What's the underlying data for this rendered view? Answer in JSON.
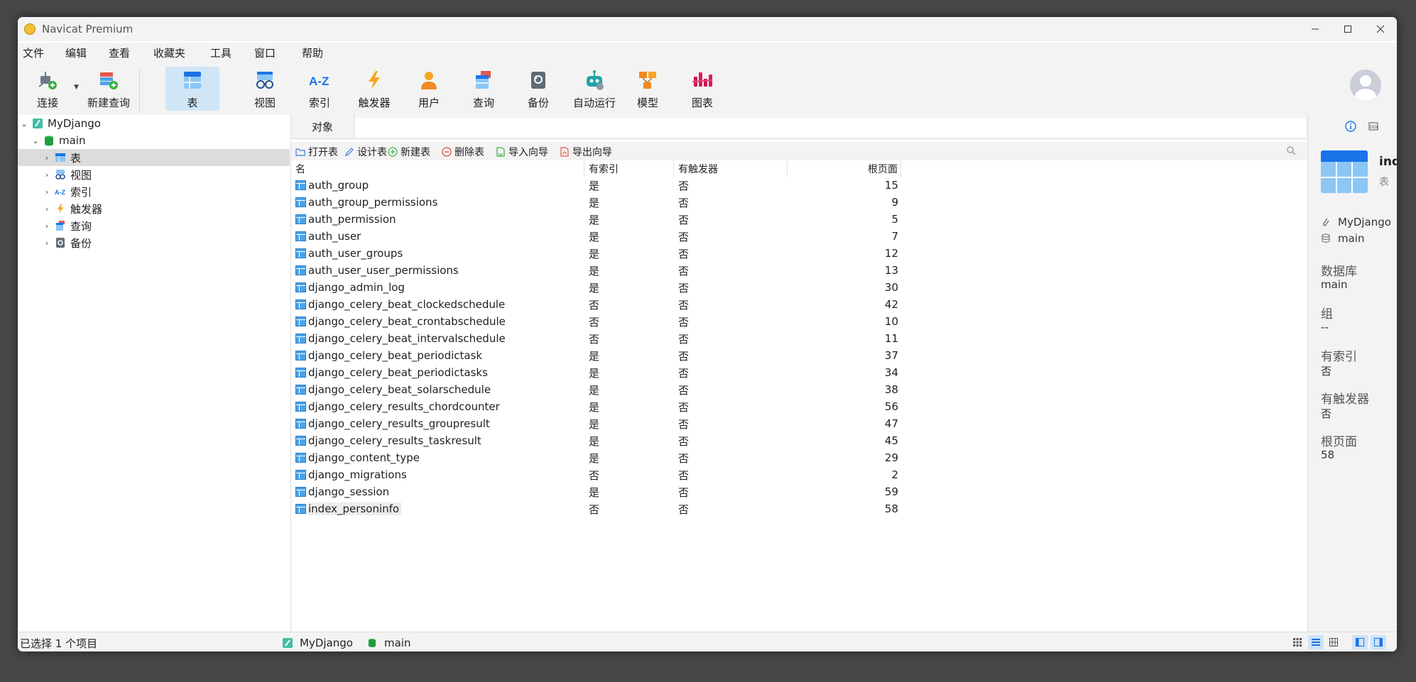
{
  "window": {
    "title": "Navicat Premium"
  },
  "menu": [
    "文件",
    "编辑",
    "查看",
    "收藏夹",
    "工具",
    "窗口",
    "帮助"
  ],
  "toolbar": {
    "connect": "连接",
    "new_query": "新建查询",
    "table": "表",
    "view": "视图",
    "index": "索引",
    "trigger": "触发器",
    "user": "用户",
    "query": "查询",
    "backup": "备份",
    "automation": "自动运行",
    "model": "模型",
    "chart": "图表"
  },
  "tree": {
    "connection": "MyDjango",
    "database": "main",
    "items": [
      "表",
      "视图",
      "索引",
      "触发器",
      "查询",
      "备份"
    ]
  },
  "tab": {
    "objects": "对象"
  },
  "object_toolbar": {
    "open": "打开表",
    "design": "设计表",
    "new": "新建表",
    "delete": "删除表",
    "import": "导入向导",
    "export": "导出向导"
  },
  "table": {
    "headers": [
      "名",
      "有索引",
      "有触发器",
      "根页面"
    ],
    "rows": [
      {
        "name": "auth_group",
        "has_index": "是",
        "has_trigger": "否",
        "root_page": "15"
      },
      {
        "name": "auth_group_permissions",
        "has_index": "是",
        "has_trigger": "否",
        "root_page": "9"
      },
      {
        "name": "auth_permission",
        "has_index": "是",
        "has_trigger": "否",
        "root_page": "5"
      },
      {
        "name": "auth_user",
        "has_index": "是",
        "has_trigger": "否",
        "root_page": "7"
      },
      {
        "name": "auth_user_groups",
        "has_index": "是",
        "has_trigger": "否",
        "root_page": "12"
      },
      {
        "name": "auth_user_user_permissions",
        "has_index": "是",
        "has_trigger": "否",
        "root_page": "13"
      },
      {
        "name": "django_admin_log",
        "has_index": "是",
        "has_trigger": "否",
        "root_page": "30"
      },
      {
        "name": "django_celery_beat_clockedschedule",
        "has_index": "否",
        "has_trigger": "否",
        "root_page": "42"
      },
      {
        "name": "django_celery_beat_crontabschedule",
        "has_index": "否",
        "has_trigger": "否",
        "root_page": "10"
      },
      {
        "name": "django_celery_beat_intervalschedule",
        "has_index": "否",
        "has_trigger": "否",
        "root_page": "11"
      },
      {
        "name": "django_celery_beat_periodictask",
        "has_index": "是",
        "has_trigger": "否",
        "root_page": "37"
      },
      {
        "name": "django_celery_beat_periodictasks",
        "has_index": "是",
        "has_trigger": "否",
        "root_page": "34"
      },
      {
        "name": "django_celery_beat_solarschedule",
        "has_index": "是",
        "has_trigger": "否",
        "root_page": "38"
      },
      {
        "name": "django_celery_results_chordcounter",
        "has_index": "是",
        "has_trigger": "否",
        "root_page": "56"
      },
      {
        "name": "django_celery_results_groupresult",
        "has_index": "是",
        "has_trigger": "否",
        "root_page": "47"
      },
      {
        "name": "django_celery_results_taskresult",
        "has_index": "是",
        "has_trigger": "否",
        "root_page": "45"
      },
      {
        "name": "django_content_type",
        "has_index": "是",
        "has_trigger": "否",
        "root_page": "29"
      },
      {
        "name": "django_migrations",
        "has_index": "否",
        "has_trigger": "否",
        "root_page": "2"
      },
      {
        "name": "django_session",
        "has_index": "是",
        "has_trigger": "否",
        "root_page": "59"
      },
      {
        "name": "index_personinfo",
        "has_index": "否",
        "has_trigger": "否",
        "root_page": "58"
      }
    ]
  },
  "side_panel": {
    "object_name": "index",
    "object_type": "表",
    "connection": "MyDjango",
    "database_name": "main",
    "fields": [
      {
        "label": "数据库",
        "value": "main"
      },
      {
        "label": "组",
        "value": "--"
      },
      {
        "label": "有索引",
        "value": "否"
      },
      {
        "label": "有触发器",
        "value": "否"
      },
      {
        "label": "根页面",
        "value": "58"
      }
    ]
  },
  "status": {
    "selection": "已选择 1 个项目",
    "connection": "MyDjango",
    "database": "main"
  },
  "colors": {
    "accent": "#1a73e8",
    "table_icon": "#4aa3e8",
    "active_tool": "#d0e6f7",
    "tree_selected": "#dcdcdc"
  }
}
